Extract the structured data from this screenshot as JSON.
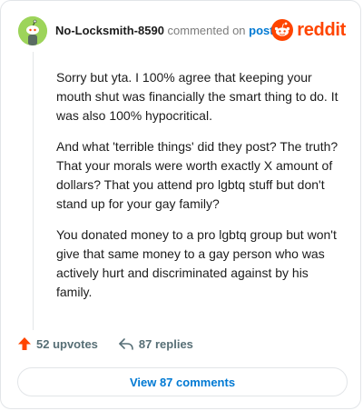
{
  "comment": {
    "username": "No-Locksmith-8590",
    "commented_text": "commented on",
    "post_link": "post",
    "paragraphs": [
      "Sorry but yta. I 100% agree that keeping your mouth shut was financially the smart thing to do. It was also 100% hypocritical.",
      "And what 'terrible things' did they post? The truth? That your morals were worth exactly X amount of dollars? That you attend pro lgbtq stuff but don't stand up for your gay family?",
      "You donated money to a pro lgbtq group but won't give that same money to a gay person who was actively hurt and discriminated against by his family."
    ]
  },
  "brand": {
    "wordmark": "reddit",
    "color": "#ff4500"
  },
  "actions": {
    "upvotes": "52 upvotes",
    "replies": "87 replies",
    "view_comments": "View 87 comments"
  },
  "icons": {
    "avatar": "snoo-avatar-icon",
    "logo": "reddit-logo-icon",
    "upvote": "upvote-arrow-icon",
    "reply": "reply-arrow-icon"
  }
}
